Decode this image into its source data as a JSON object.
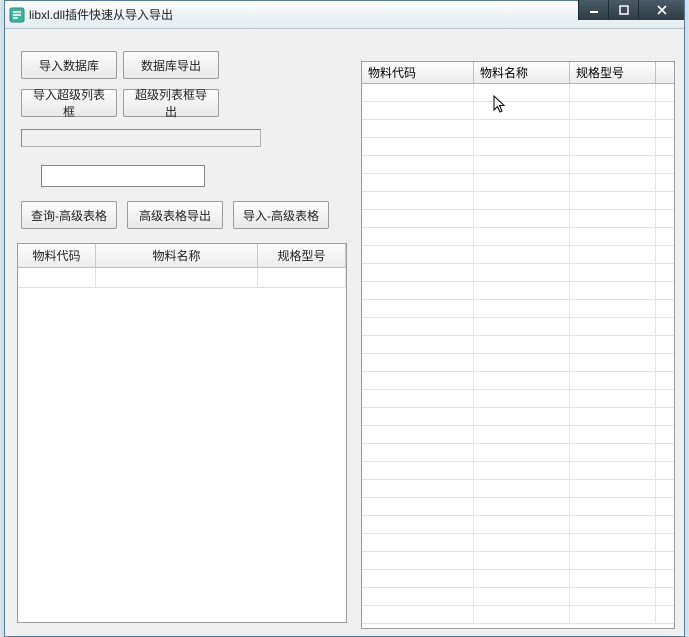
{
  "window": {
    "title": "libxl.dll插件快速从导入导出"
  },
  "buttons": {
    "import_db": "导入数据库",
    "export_db": "数据库导出",
    "import_superlist": "导入超级列表框",
    "export_superlist": "超级列表框导出",
    "query_advtable": "查询-高级表格",
    "export_advtable": "高级表格导出",
    "import_advtable": "导入-高级表格"
  },
  "textbox": {
    "value": ""
  },
  "left_table": {
    "headers": [
      "物料代码",
      "物料名称",
      "规格型号"
    ]
  },
  "right_table": {
    "headers": [
      "物料代码",
      "物料名称",
      "规格型号"
    ]
  }
}
